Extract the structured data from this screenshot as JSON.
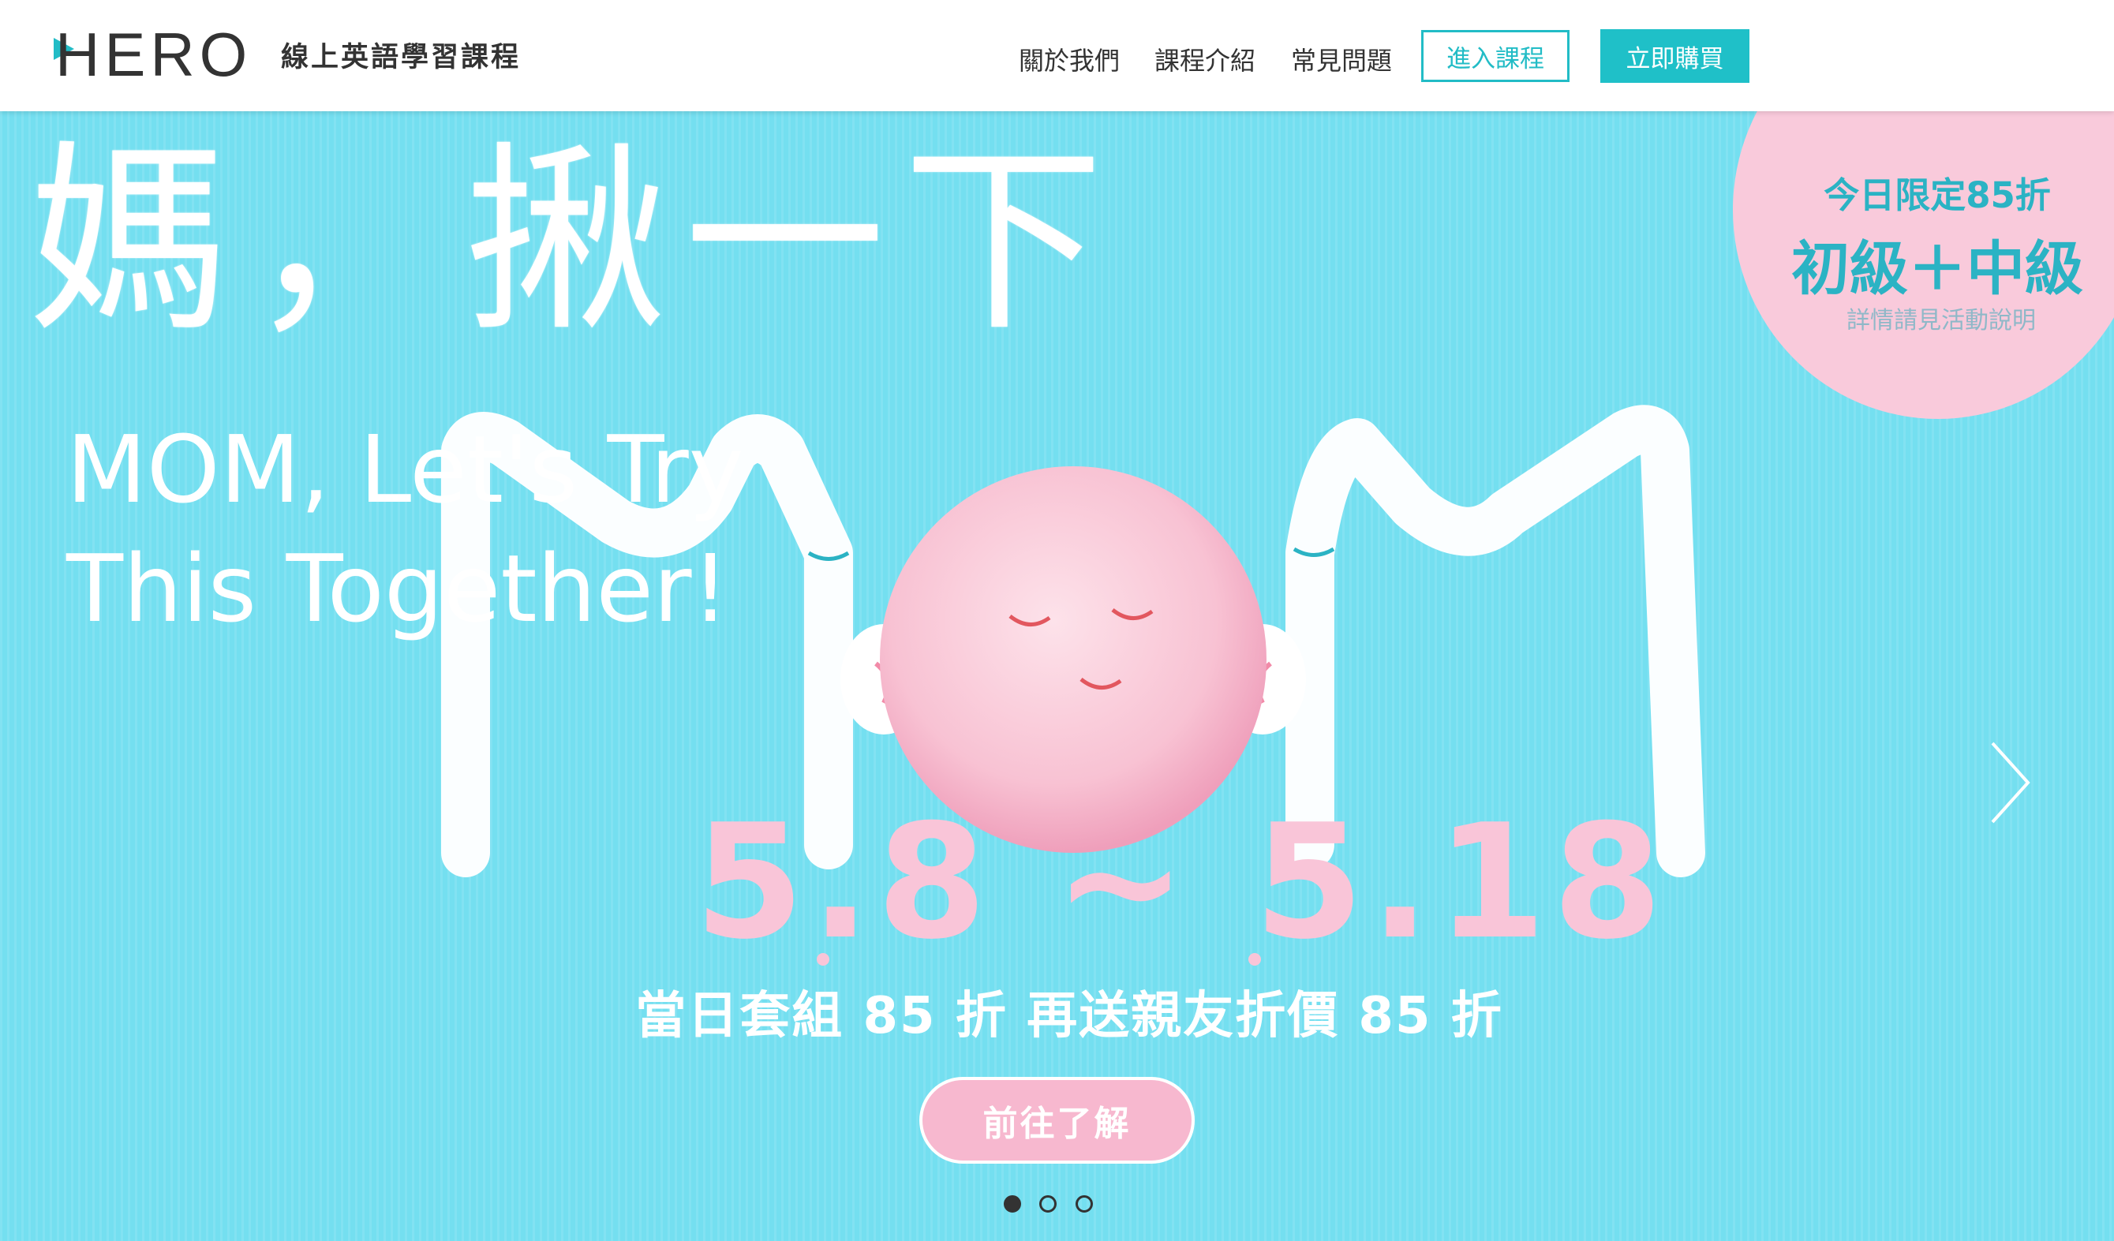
{
  "header": {
    "logo_text": "HERO",
    "tagline": "線上英語學習課程",
    "nav": [
      {
        "label": "關於我們"
      },
      {
        "label": "課程介紹"
      },
      {
        "label": "常見問題"
      }
    ],
    "enter_course_label": "進入課程",
    "buy_now_label": "立即購買"
  },
  "hero": {
    "title_zh": "媽，揪一下",
    "title_en_line1": "MOM, Let's Try",
    "title_en_line2": "This Together!",
    "dates": "5.8 ~ 5.18",
    "offer": "當日套組 85 折  再送親友折價 85 折",
    "cta_label": "前往了解",
    "badge": {
      "line1": "今日限定85折",
      "line2": "初級＋中級",
      "line3": "詳情請見活動說明"
    },
    "carousel": {
      "slide_count": 3,
      "active_index": 0
    }
  },
  "colors": {
    "accent": "#1fc0c8",
    "hero_bg": "#74dff0",
    "pink": "#f9cadb",
    "badge_text": "#2bb3c4"
  }
}
